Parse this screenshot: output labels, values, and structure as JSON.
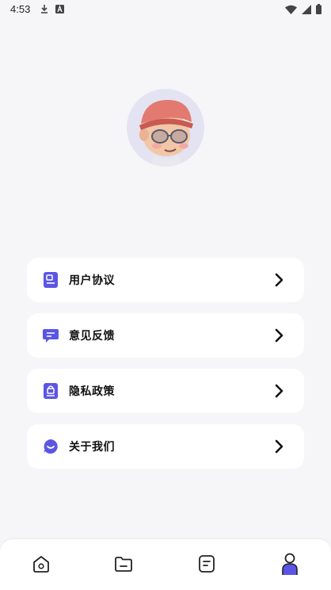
{
  "status_bar": {
    "time": "4:53",
    "icons": [
      "download-icon",
      "text-a-icon",
      "wifi-icon",
      "signal-icon",
      "battery-icon"
    ]
  },
  "profile": {
    "avatar": "avatar-3d-character"
  },
  "menu": {
    "items": [
      {
        "label": "用户协议",
        "icon": "document-icon"
      },
      {
        "label": "意见反馈",
        "icon": "chat-message-icon"
      },
      {
        "label": "隐私政策",
        "icon": "lock-document-icon"
      },
      {
        "label": "关于我们",
        "icon": "smile-chat-icon"
      }
    ]
  },
  "bottom_nav": {
    "items": [
      {
        "icon": "home-icon",
        "active": false
      },
      {
        "icon": "folder-icon",
        "active": false
      },
      {
        "icon": "note-icon",
        "active": false
      },
      {
        "icon": "profile-icon",
        "active": true
      }
    ]
  },
  "colors": {
    "accent": "#5b55e6",
    "background": "#f6f6f9",
    "card": "#ffffff",
    "avatar_bg": "#e4e3f2"
  }
}
